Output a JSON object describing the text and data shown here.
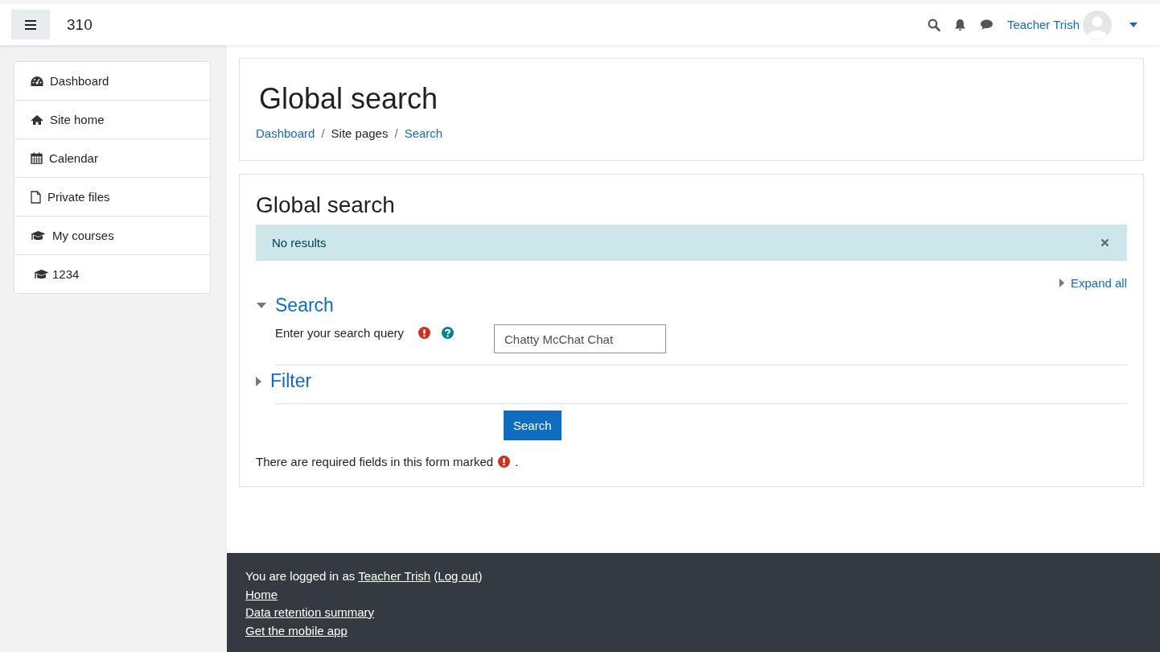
{
  "navbar": {
    "site_name": "310",
    "user_name": "Teacher Trish"
  },
  "sidebar": {
    "items": [
      {
        "label": "Dashboard",
        "kind": "dashboard"
      },
      {
        "label": "Site home",
        "kind": "home"
      },
      {
        "label": "Calendar",
        "kind": "calendar"
      },
      {
        "label": "Private files",
        "kind": "file"
      },
      {
        "label": "My courses",
        "kind": "courses",
        "children": [
          {
            "label": "1234",
            "kind": "courses"
          }
        ]
      }
    ]
  },
  "header": {
    "title": "Global search",
    "separator": "/",
    "breadcrumb": [
      {
        "label": "Dashboard",
        "link": true
      },
      {
        "label": "Site pages",
        "link": false
      },
      {
        "label": "Search",
        "link": true
      }
    ]
  },
  "main": {
    "heading": "Global search",
    "alert": "No results",
    "expand_all": "Expand all",
    "sections": [
      {
        "title": "Search",
        "expanded": true,
        "fields": [
          {
            "label": "Enter your search query",
            "required": true,
            "value": "Chatty McChat Chat"
          }
        ]
      },
      {
        "title": "Filter",
        "expanded": false
      }
    ],
    "submit": "Search",
    "required_note": "There are required fields in this form marked",
    "required_note_end": "."
  },
  "footer": {
    "login_prefix": "You are logged in as",
    "user_link": "Teacher Trish",
    "open_paren": "(",
    "logout_link": "Log out",
    "close_paren": ")",
    "links": [
      "Home",
      "Data retention summary",
      "Get the mobile app"
    ]
  }
}
